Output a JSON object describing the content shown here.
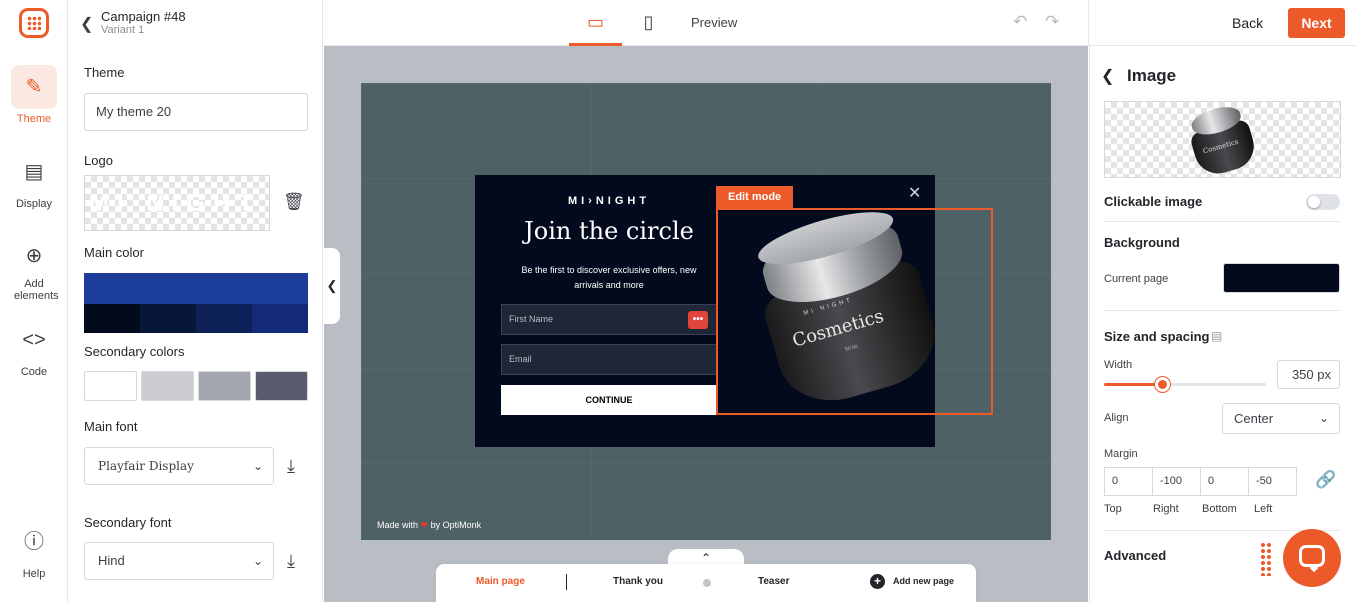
{
  "rail": {
    "items": [
      {
        "label": "Theme",
        "icon": "paint-brush-icon"
      },
      {
        "label": "Display",
        "icon": "monitor-icon"
      },
      {
        "label": "Add elements",
        "icon": "plus-circle-icon"
      },
      {
        "label": "Code",
        "icon": "code-icon"
      },
      {
        "label": "Help",
        "icon": "help-icon"
      }
    ]
  },
  "campaign": {
    "title": "Campaign #48",
    "variant": "Variant 1"
  },
  "theme_panel": {
    "theme_label": "Theme",
    "theme_value": "My theme 20",
    "logo_label": "Logo",
    "logo_text": "MI NIGHT",
    "main_color_label": "Main color",
    "main_color": "#1c3d9a",
    "main_color_shades": [
      "#030a1e",
      "#081638",
      "#0d2158",
      "#132b78"
    ],
    "secondary_colors_label": "Secondary colors",
    "secondary_colors": [
      "#ffffff",
      "#cbcdd1",
      "#a3a6ae",
      "#585c6d"
    ],
    "main_font_label": "Main font",
    "main_font_value": "Playfair Display",
    "secondary_font_label": "Secondary font",
    "secondary_font_value": "Hind"
  },
  "topbar": {
    "preview_label": "Preview",
    "back_label": "Back",
    "next_label": "Next",
    "accent": "#ed5a29"
  },
  "canvas": {
    "made_with_prefix": "Made with",
    "made_with_suffix": "by OptiMonk",
    "popup": {
      "brand": "MI›NIGHT",
      "headline": "Join the circle",
      "subline": "Be the first to discover exclusive offers, new arrivals and more",
      "first_name_placeholder": "First Name",
      "email_placeholder": "Email",
      "cta_label": "CONTINUE",
      "edit_badge": "Edit mode",
      "jar_brand": "MI NIGHT",
      "jar_word": "Cosmetics",
      "jar_ml": "50 ML"
    },
    "pages": {
      "main_page": "Main page",
      "thank_you": "Thank you",
      "teaser": "Teaser",
      "add_new_page": "Add new page"
    }
  },
  "image_panel": {
    "title": "Image",
    "mini_jar_word": "Cosmetics",
    "clickable_label": "Clickable image",
    "clickable_on": false,
    "background_label": "Background",
    "current_page_label": "Current page",
    "background_color": "#030a1e",
    "size_label": "Size and spacing",
    "width_label": "Width",
    "width_value": "350 px",
    "width_slider_fraction": 0.36,
    "align_label": "Align",
    "align_value": "Center",
    "margin_label": "Margin",
    "margins": {
      "top": "0",
      "right": "-100",
      "bottom": "0",
      "left": "-50"
    },
    "margin_captions": {
      "top": "Top",
      "right": "Right",
      "bottom": "Bottom",
      "left": "Left"
    },
    "advanced_label": "Advanced"
  }
}
